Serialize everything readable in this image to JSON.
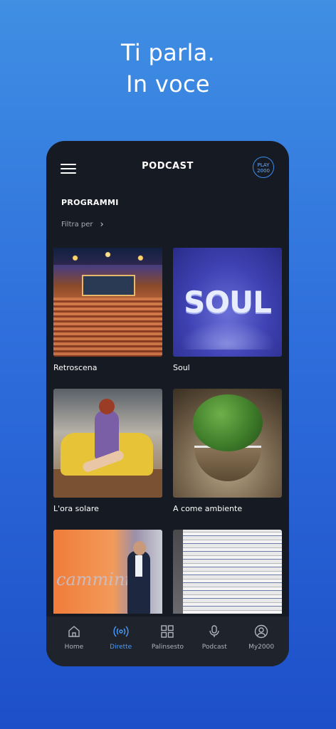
{
  "hero": {
    "line1": "Ti parla.",
    "line2": "In voce"
  },
  "header": {
    "title": "PODCAST",
    "logo_line1": "PLAY",
    "logo_line2": "2000"
  },
  "section": {
    "title": "PROGRAMMI",
    "filter_label": "Filtra per"
  },
  "programs": [
    {
      "label": "Retroscena"
    },
    {
      "label": "Soul",
      "art_text": "SOUL"
    },
    {
      "label": "L'ora solare"
    },
    {
      "label": "A come ambiente"
    },
    {
      "label": "",
      "art_text": "cammini"
    },
    {
      "label": ""
    }
  ],
  "tabs": [
    {
      "label": "Home",
      "icon": "home-icon"
    },
    {
      "label": "Dirette",
      "icon": "broadcast-icon",
      "active": true
    },
    {
      "label": "Palinsesto",
      "icon": "grid-icon"
    },
    {
      "label": "Podcast",
      "icon": "microphone-icon"
    },
    {
      "label": "My2000",
      "icon": "user-icon"
    }
  ],
  "colors": {
    "accent": "#4a9bff",
    "background": "#161a22",
    "gradient_top": "#3f8fe3",
    "gradient_bottom": "#1d4fc9"
  }
}
